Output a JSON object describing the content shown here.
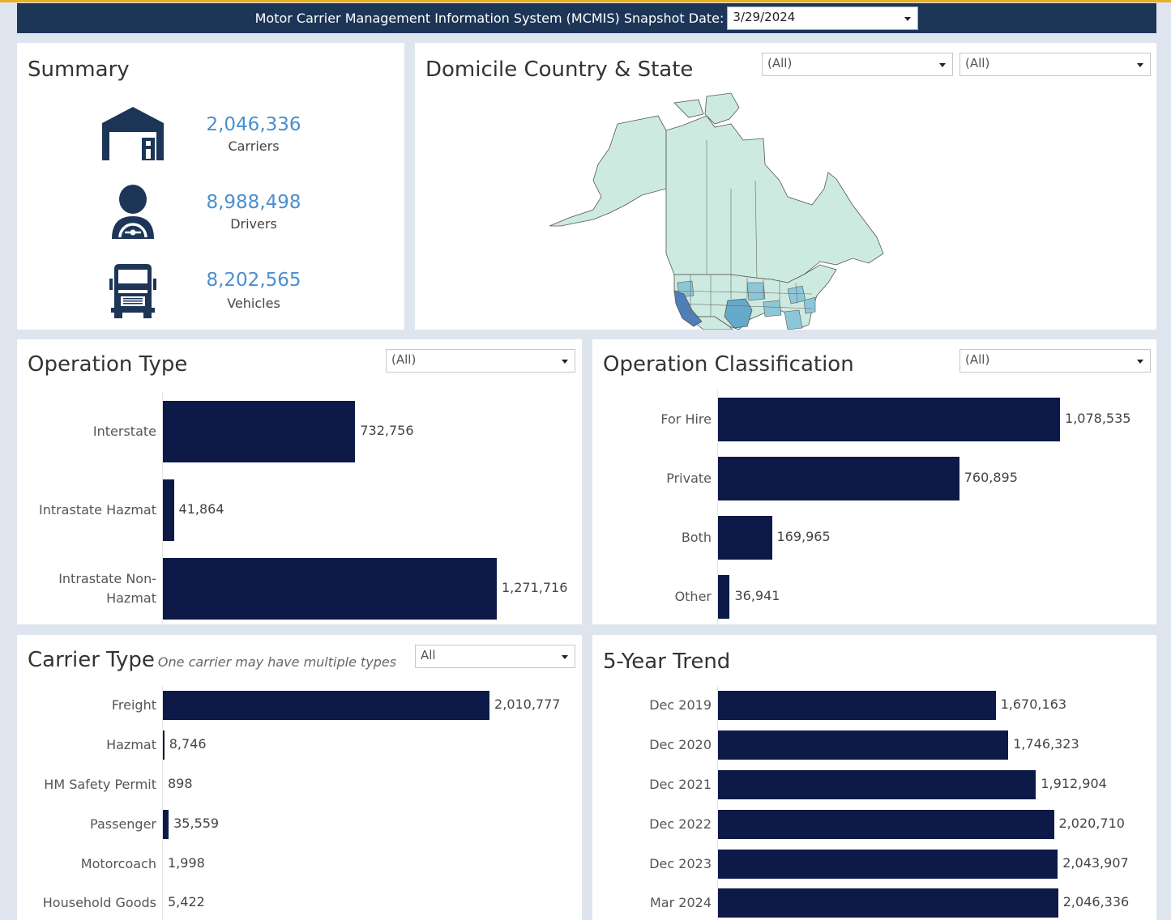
{
  "header": {
    "title": "Motor Carrier Management Information System (MCMIS) Snapshot Date:",
    "snapshot_date": "3/29/2024"
  },
  "summary": {
    "title": "Summary",
    "carriers": {
      "value": "2,046,336",
      "label": "Carriers",
      "icon": "warehouse-icon"
    },
    "drivers": {
      "value": "8,988,498",
      "label": "Drivers",
      "icon": "driver-icon"
    },
    "vehicles": {
      "value": "8,202,565",
      "label": "Vehicles",
      "icon": "truck-icon"
    }
  },
  "domicile": {
    "title": "Domicile Country & State",
    "country_filter": "(All)",
    "state_filter": "(All)"
  },
  "operation_type": {
    "title": "Operation Type",
    "filter": "(All)"
  },
  "operation_classification": {
    "title": "Operation Classification",
    "filter": "(All)"
  },
  "carrier_type": {
    "title": "Carrier Type",
    "subtitle": "One carrier may have multiple types",
    "filter": "All"
  },
  "trend": {
    "title": "5-Year Trend"
  },
  "colors": {
    "bar": "#0d1a47",
    "header": "#1d3657",
    "accent_number": "#4a8fce",
    "top_line": "#e8b022"
  },
  "chart_data": [
    {
      "type": "bar",
      "orientation": "horizontal",
      "id": "operation_type",
      "categories": [
        "Interstate",
        "Intrastate Hazmat",
        "Intrastate Non-Hazmat"
      ],
      "values": [
        732756,
        41864,
        1271716
      ],
      "value_labels": [
        "732,756",
        "41,864",
        "1,271,716"
      ],
      "xlim": [
        0,
        1420000
      ]
    },
    {
      "type": "bar",
      "orientation": "horizontal",
      "id": "operation_classification",
      "categories": [
        "For Hire",
        "Private",
        "Both",
        "Other"
      ],
      "values": [
        1078535,
        760895,
        169965,
        36941
      ],
      "value_labels": [
        "1,078,535",
        "760,895",
        "169,965",
        "36,941"
      ],
      "xlim": [
        0,
        1380000
      ]
    },
    {
      "type": "bar",
      "orientation": "horizontal",
      "id": "carrier_type",
      "categories": [
        "Freight",
        "Hazmat",
        "HM Safety Permit",
        "Passenger",
        "Motorcoach",
        "Household Goods"
      ],
      "values": [
        2010777,
        8746,
        898,
        35559,
        1998,
        5422
      ],
      "value_labels": [
        "2,010,777",
        "8,746",
        "898",
        "35,559",
        "1,998",
        "5,422"
      ],
      "xlim": [
        0,
        2245000
      ]
    },
    {
      "type": "bar",
      "orientation": "horizontal",
      "id": "five_year_trend",
      "categories": [
        "Dec 2019",
        "Dec 2020",
        "Dec 2021",
        "Dec 2022",
        "Dec 2023",
        "Mar 2024"
      ],
      "values": [
        1670163,
        1746323,
        1912904,
        2020710,
        2043907,
        2046336
      ],
      "value_labels": [
        "1,670,163",
        "1,746,323",
        "1,912,904",
        "2,020,710",
        "2,043,907",
        "2,046,336"
      ],
      "xlim": [
        0,
        2730000
      ]
    }
  ]
}
